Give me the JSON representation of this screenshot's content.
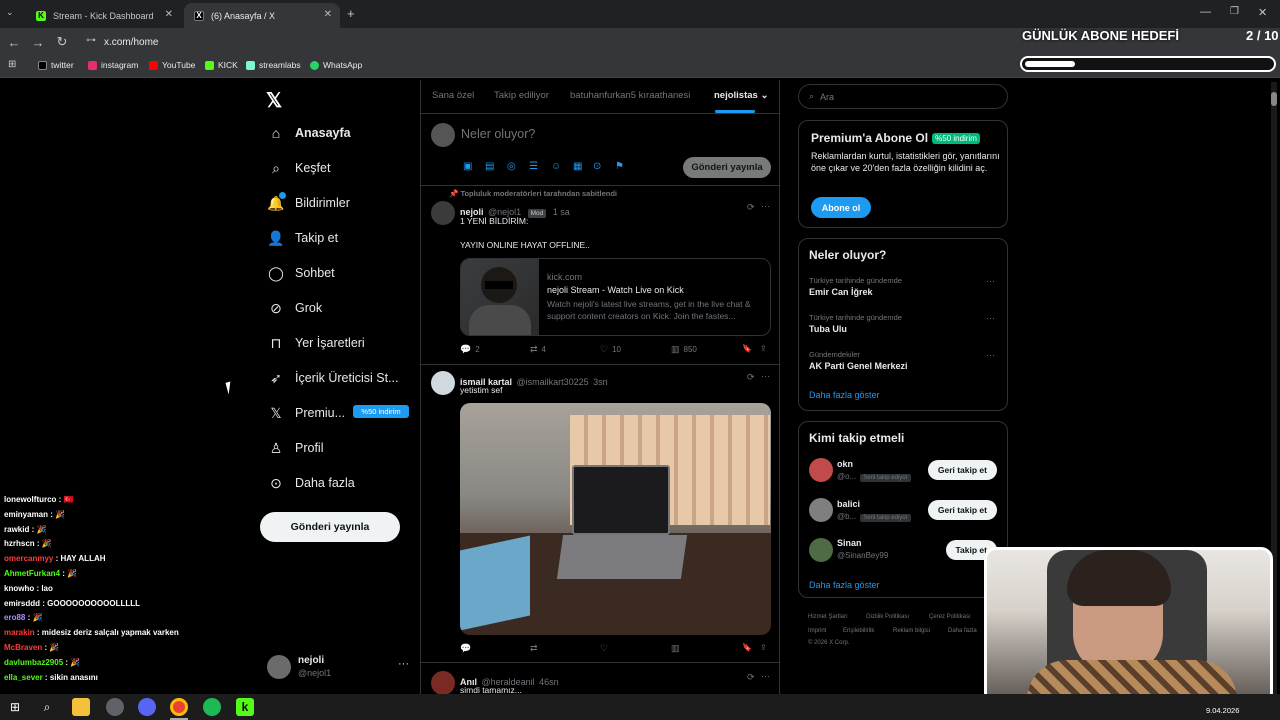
{
  "browser": {
    "tabs": [
      {
        "label": "Stream - Kick Dashboard",
        "favicon": "kick-icon"
      },
      {
        "label": "(6) Anasayfa / X",
        "favicon": "x-icon"
      }
    ],
    "url": "x.com/home",
    "bookmarks": [
      "twitter",
      "instagram",
      "YouTube",
      "KICK",
      "streamlabs",
      "WhatsApp"
    ]
  },
  "goal": {
    "title": "GÜNLÜK ABONE HEDEFİ",
    "count": "2 / 10",
    "progress": 0.2
  },
  "sidebar": {
    "items": [
      {
        "label": "Anasayfa",
        "icon": "home-icon"
      },
      {
        "label": "Keşfet",
        "icon": "search-icon"
      },
      {
        "label": "Bildirimler",
        "icon": "bell-icon"
      },
      {
        "label": "Takip et",
        "icon": "add-user-icon"
      },
      {
        "label": "Sohbet",
        "icon": "chat-icon"
      },
      {
        "label": "Grok",
        "icon": "grok-icon"
      },
      {
        "label": "Yer İşaretleri",
        "icon": "bookmark-icon"
      },
      {
        "label": "İçerik Üreticisi St...",
        "icon": "rocket-icon"
      },
      {
        "label": "Premiu...",
        "icon": "x-icon"
      },
      {
        "label": "Profil",
        "icon": "profile-icon"
      },
      {
        "label": "Daha fazla",
        "icon": "more-icon"
      }
    ],
    "premium_badge": "%50 indirim",
    "post_button": "Gönderi yayınla",
    "account": {
      "name": "nejoli",
      "handle": "@nejol1"
    }
  },
  "feed": {
    "tabs": [
      "Sana özel",
      "Takip ediliyor",
      "batuhanfurkan5 kıraathanesi",
      "nejolistas"
    ],
    "compose_placeholder": "Neler oluyor?",
    "compose_button": "Gönderi yayınla",
    "pinned_label": "Topluluk moderatörleri tarafından sabitlendi",
    "posts": [
      {
        "name": "nejoli",
        "handle": "@nejol1",
        "badge": "Mod",
        "time": "1 sa",
        "line1": "1 YENİ BİLDİRİM:",
        "line2": "YAYIN ONLINE HAYAT OFFLINE..",
        "card_domain": "kick.com",
        "card_title": "nejoli Stream - Watch Live on Kick",
        "card_desc": "Watch nejoli's latest live streams, get in the live chat & support content creators on Kick. Join the fastes...",
        "replies": "2",
        "reposts": "4",
        "likes": "10",
        "views": "850"
      },
      {
        "name": "ismail kartal",
        "handle": "@ismailkart30225",
        "time": "3sn",
        "text": "yetistim sef"
      },
      {
        "name": "Anıl",
        "handle": "@heraldeanil",
        "time": "46sn",
        "text": "simdi tamamız..."
      }
    ]
  },
  "right": {
    "search_placeholder": "Ara",
    "premium": {
      "title": "Premium'a Abone Ol",
      "pct": "%50 indirim",
      "desc": "Reklamlardan kurtul, istatistikleri gör, yanıtlarını öne çıkar ve 20'den fazla özelliğin kilidini aç.",
      "button": "Abone ol"
    },
    "trends": {
      "title": "Neler oluyor?",
      "items": [
        {
          "category": "Türkiye tarihinde gündemde",
          "name": "Emir Can İğrek"
        },
        {
          "category": "Türkiye tarihinde gündemde",
          "name": "Tuba Ulu"
        },
        {
          "category": "Gündemdekiler",
          "name": "AK Parti Genel Merkezi"
        }
      ],
      "show_more": "Daha fazla göster"
    },
    "who_to_follow": {
      "title": "Kimi takip etmeli",
      "items": [
        {
          "name": "okn",
          "handle": "@o...",
          "follows_you": "Seni takip ediyor",
          "button": "Geri takip et"
        },
        {
          "name": "balici",
          "handle": "@b...",
          "follows_you": "Seni takip ediyor",
          "button": "Geri takip et"
        },
        {
          "name": "Sinan",
          "handle": "@SinanBey99",
          "follows_you": "",
          "button": "Takip et"
        }
      ],
      "show_more": "Daha fazla göster"
    },
    "footer": {
      "line1": [
        "Hizmet Şartları",
        "Gizlilik Politikası",
        "Çerez Politikası"
      ],
      "line2": [
        "Imprint",
        "Erişilebilirlik",
        "Reklam bilgisi",
        "Daha fazla"
      ],
      "copyright": "© 2026 X Corp."
    }
  },
  "chat": [
    {
      "user": "lonewolfturco",
      "msg": "🇹🇷",
      "color": "#ffffff"
    },
    {
      "user": "eminyaman",
      "msg": "🎉",
      "color": "#ffffff"
    },
    {
      "user": "rawkid",
      "msg": "🎉",
      "color": "#ffffff"
    },
    {
      "user": "hzrhscn",
      "msg": "🎉",
      "color": "#ffffff"
    },
    {
      "user": "omercanmyy",
      "msg": "HAY ALLAH",
      "color": "#ff3b3b"
    },
    {
      "user": "AhmetFurkan4",
      "msg": "🎉",
      "color": "#53fc18"
    },
    {
      "user": "knowho",
      "msg": "lao",
      "color": "#ffffff"
    },
    {
      "user": "emirsddd",
      "msg": "GOOOOOOOOOOLLLLL",
      "color": "#ffffff"
    },
    {
      "user": "ero88",
      "msg": "🎉",
      "color": "#b08cff"
    },
    {
      "user": "marakin",
      "msg": "midesiz deriz salçalı yapmak varken",
      "color": "#ff3b3b"
    },
    {
      "user": "McBraven",
      "msg": "🎉",
      "color": "#ff3b3b"
    },
    {
      "user": "davlumbaz2905",
      "msg": "🎉",
      "color": "#53fc18"
    },
    {
      "user": "ella_sever",
      "msg": "sikin anasını",
      "color": "#53fc18"
    }
  ],
  "taskbar": {
    "date": "9.04.2026"
  }
}
